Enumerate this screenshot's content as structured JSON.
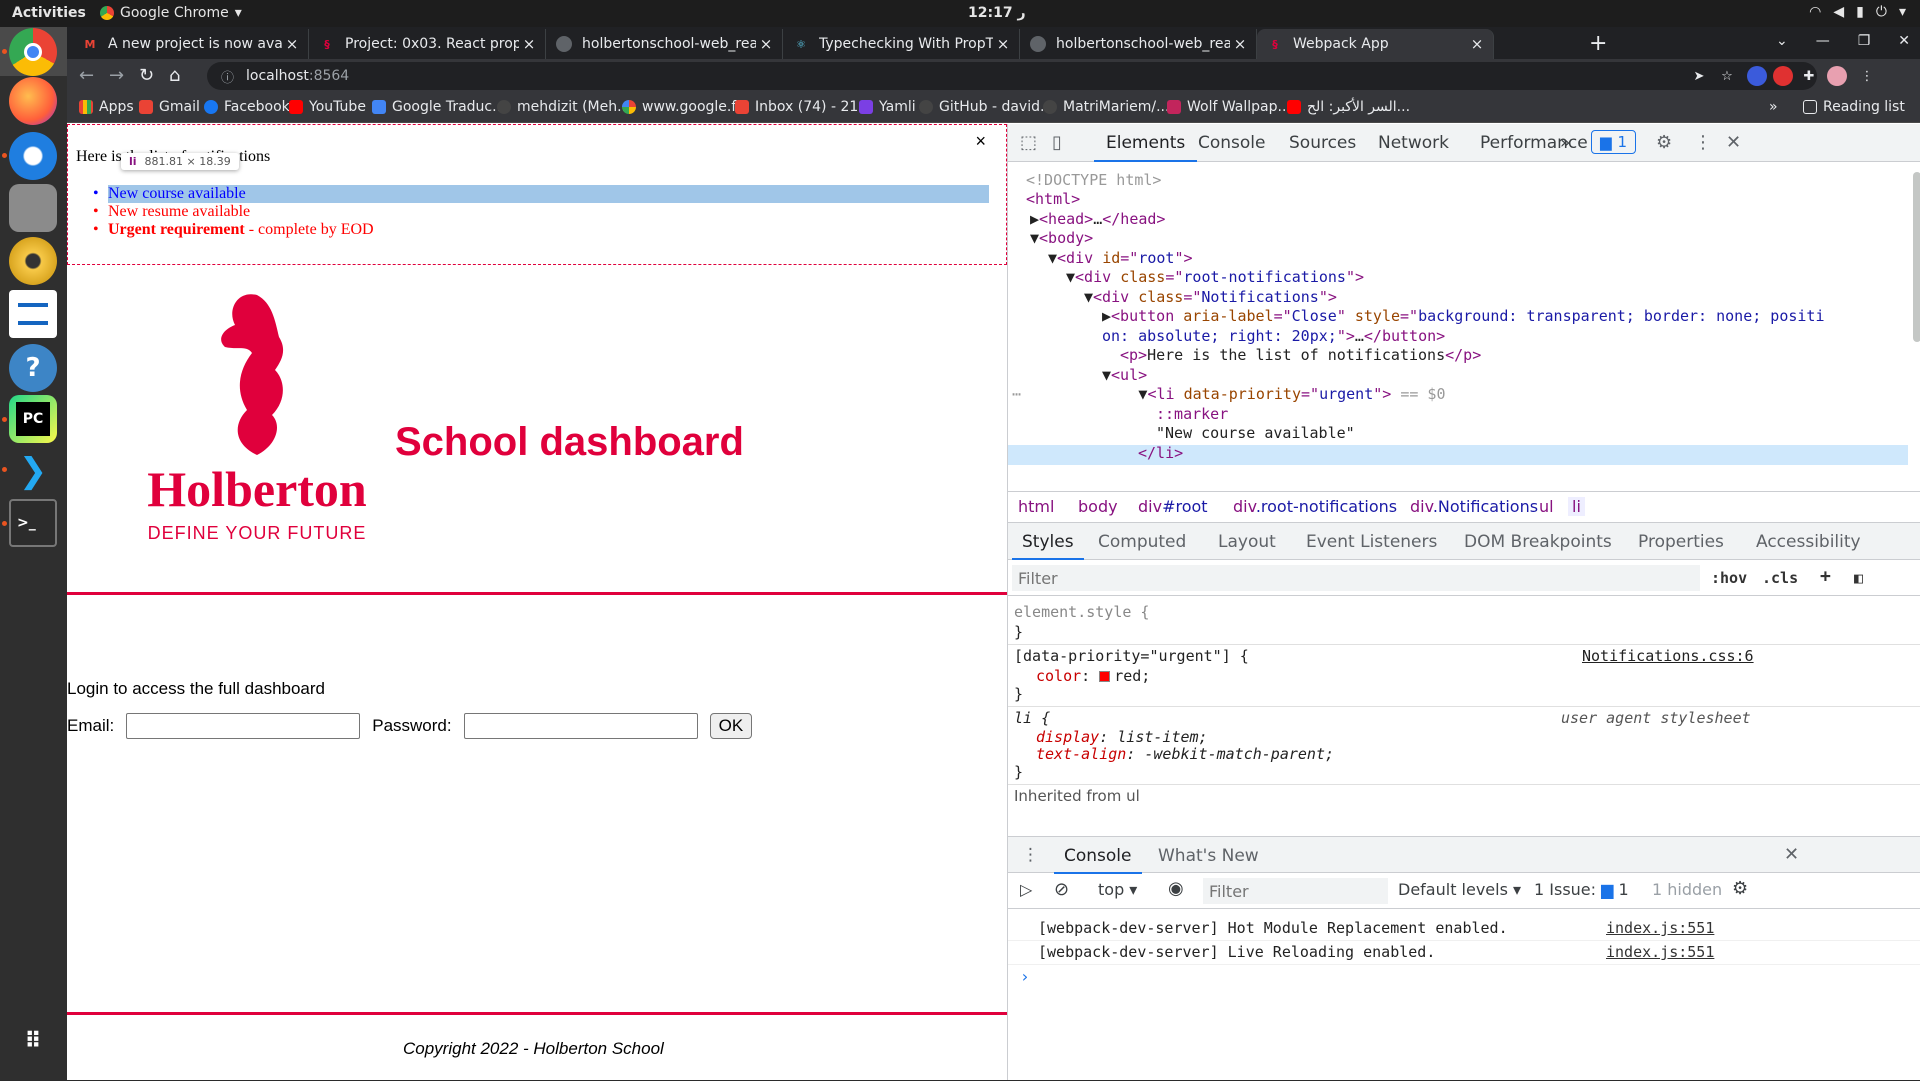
{
  "topbar": {
    "activities": "Activities",
    "app_name": "Google Chrome",
    "clock": "12:17 ر"
  },
  "dock": {
    "items": [
      "Chrome",
      "Firefox",
      "Thunderbird",
      "Files",
      "Rhythmbox",
      "Writer",
      "Help",
      "PyCharm",
      "VS Code",
      "Terminal",
      "Show Applications"
    ]
  },
  "tabs": [
    {
      "title": "A new project is now avai",
      "icon": "gmail-icon",
      "color": "#ea4335"
    },
    {
      "title": "Project: 0x03. React props",
      "icon": "holberton-icon",
      "color": "#e0003c"
    },
    {
      "title": "holbertonschool-web_rea",
      "icon": "github-icon",
      "color": "#e8eaed"
    },
    {
      "title": "Typechecking With PropT",
      "icon": "react-icon",
      "color": "#61dafb"
    },
    {
      "title": "holbertonschool-web_rea",
      "icon": "github-icon",
      "color": "#e8eaed"
    },
    {
      "title": "Webpack App",
      "icon": "holberton-icon",
      "color": "#e0003c"
    }
  ],
  "toolbar": {
    "url_host": "localhost",
    "url_port": ":8564"
  },
  "bookmarks": {
    "items": [
      "Apps",
      "Gmail",
      "Facebook",
      "YouTube",
      "Google Traduc...",
      "mehdizit (Meh...",
      "www.google.f...",
      "Inbox (74) - 21...",
      "Yamli",
      "GitHub - david...",
      "MatriMariem/...",
      "Wolf Wallpap...",
      "السر الأكبر: الح..."
    ],
    "more": "»",
    "reading_list": "Reading list"
  },
  "page": {
    "notifications": {
      "close_label": "×",
      "title": "Here is the list of notifications",
      "items": [
        {
          "text": "New course available",
          "priority": "default"
        },
        {
          "text": "New resume available",
          "priority": "urgent"
        },
        {
          "bold": "Urgent requirement",
          "rest": " - complete by EOD",
          "priority": "urgent"
        }
      ],
      "tooltip_tag": "li",
      "tooltip_dim": "881.81 × 18.39"
    },
    "header": {
      "logo_word": "Holberton",
      "logo_tagline": "DEFINE YOUR FUTURE",
      "title": "School dashboard"
    },
    "body": {
      "login_text": "Login to access the full dashboard",
      "email_label": "Email:",
      "password_label": "Password:",
      "ok_label": "OK"
    },
    "footer": {
      "text": "Copyright 2022 - Holberton School"
    }
  },
  "devtools": {
    "tabs": [
      "Elements",
      "Console",
      "Sources",
      "Network",
      "Performance"
    ],
    "more": "»",
    "issues_count": "1",
    "breadcrumbs": [
      {
        "tag": "html",
        "cls": ""
      },
      {
        "tag": "body",
        "cls": ""
      },
      {
        "tag": "div",
        "cls": "#root"
      },
      {
        "tag": "div",
        "cls": ".root-notifications"
      },
      {
        "tag": "div",
        "cls": ".Notifications"
      },
      {
        "tag": "ul",
        "cls": ""
      },
      {
        "tag": "li",
        "cls": ""
      }
    ],
    "sub_tabs": [
      "Styles",
      "Computed",
      "Layout",
      "Event Listeners",
      "DOM Breakpoints",
      "Properties",
      "Accessibility"
    ],
    "filter_placeholder": "Filter",
    "hov": ":hov",
    "cls": ".cls",
    "styles": {
      "element_style": "element.style {",
      "rule1_selector": "[data-priority=\"urgent\"] {",
      "rule1_source": "Notifications.css:6",
      "rule1_prop": "color",
      "rule1_value": "red;",
      "rule2_selector": "li {",
      "rule2_source": "user agent stylesheet",
      "rule2_props": [
        {
          "name": "display",
          "value": "list-item;"
        },
        {
          "name": "text-align",
          "value": "-webkit-match-parent;"
        }
      ],
      "inherited": "Inherited from ul"
    },
    "drawer": {
      "tabs": [
        "Console",
        "What's New"
      ],
      "context": "top",
      "filter_placeholder": "Filter",
      "levels": "Default levels",
      "issues": "1 Issue:",
      "issues_count": "1",
      "hidden": "1 hidden",
      "messages": [
        {
          "text": "[webpack-dev-server] Hot Module Replacement enabled.",
          "source": "index.js:551"
        },
        {
          "text": "[webpack-dev-server] Live Reloading enabled.",
          "source": "index.js:551"
        }
      ]
    }
  }
}
